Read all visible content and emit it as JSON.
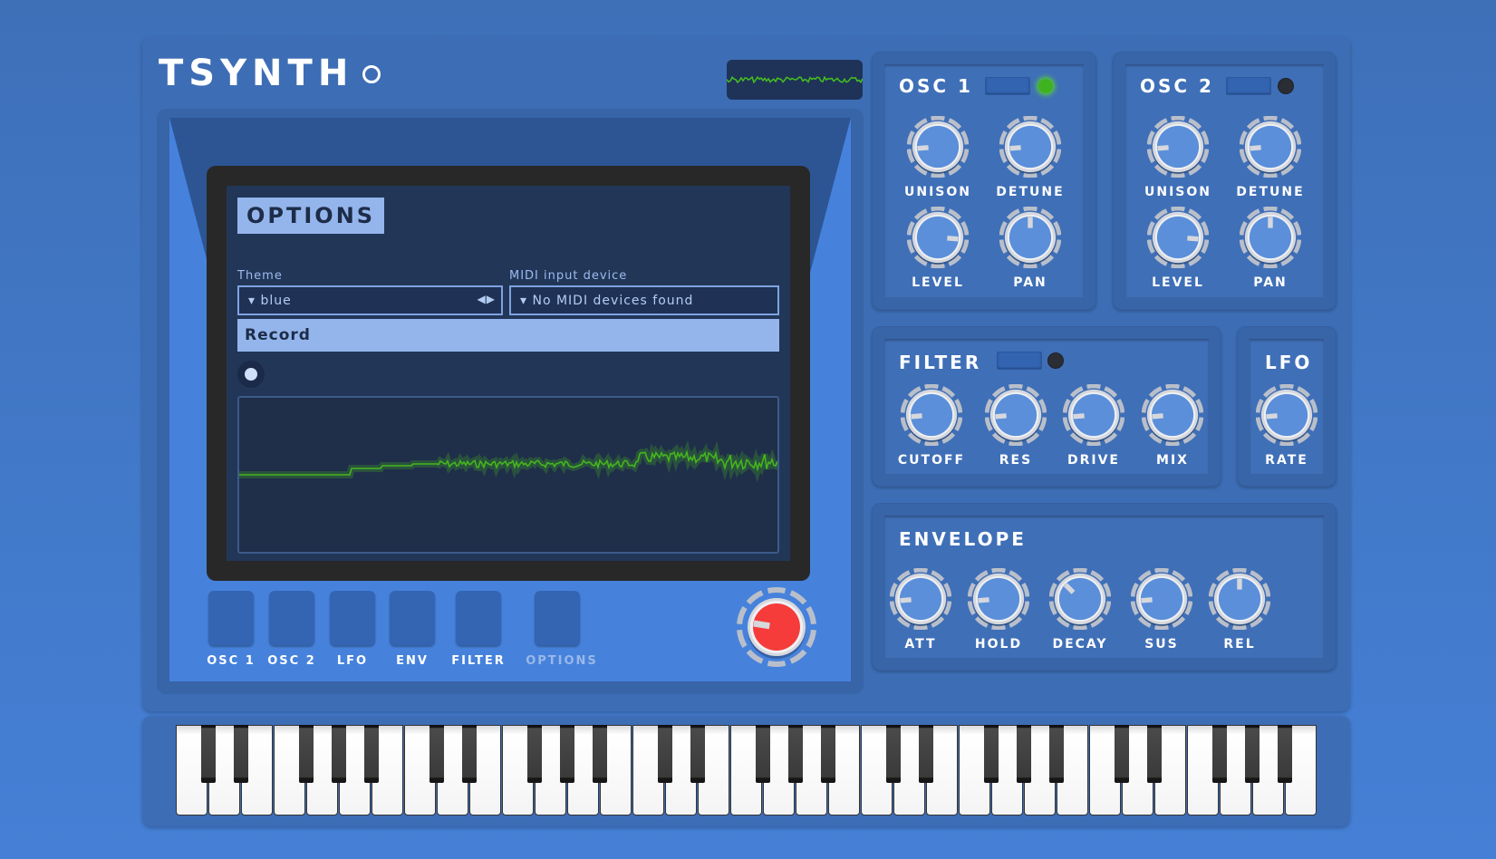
{
  "app": {
    "title": "TSYNTH",
    "github_icon": "github-icon"
  },
  "osc1": {
    "title": "OSC 1",
    "enabled": true,
    "knobs": [
      {
        "label": "UNISON",
        "value": 0.15
      },
      {
        "label": "DETUNE",
        "value": 0.15
      },
      {
        "label": "LEVEL",
        "value": 0.85
      },
      {
        "label": "PAN",
        "value": 0.5
      }
    ]
  },
  "osc2": {
    "title": "OSC 2",
    "enabled": false,
    "knobs": [
      {
        "label": "UNISON",
        "value": 0.15
      },
      {
        "label": "DETUNE",
        "value": 0.15
      },
      {
        "label": "LEVEL",
        "value": 0.85
      },
      {
        "label": "PAN",
        "value": 0.5
      }
    ]
  },
  "filter": {
    "title": "FILTER",
    "enabled": false,
    "knobs": [
      {
        "label": "CUTOFF",
        "value": 0.15
      },
      {
        "label": "RES",
        "value": 0.15
      },
      {
        "label": "DRIVE",
        "value": 0.15
      },
      {
        "label": "MIX",
        "value": 0.15
      }
    ]
  },
  "lfo": {
    "title": "LFO",
    "knobs": [
      {
        "label": "RATE",
        "value": 0.15
      }
    ]
  },
  "envelope": {
    "title": "ENVELOPE",
    "knobs": [
      {
        "label": "ATT",
        "value": 0.15
      },
      {
        "label": "HOLD",
        "value": 0.15
      },
      {
        "label": "DECAY",
        "value": 0.33
      },
      {
        "label": "SUS",
        "value": 0.15
      },
      {
        "label": "REL",
        "value": 0.5
      }
    ]
  },
  "screen": {
    "title": "OPTIONS",
    "theme_label": "Theme",
    "theme_value": "blue",
    "midi_label": "MIDI input device",
    "midi_value": "No MIDI devices found",
    "record_label": "Record"
  },
  "tabs": [
    {
      "label": "OSC 1",
      "active": false
    },
    {
      "label": "OSC 2",
      "active": false
    },
    {
      "label": "LFO",
      "active": false
    },
    {
      "label": "ENV",
      "active": false
    },
    {
      "label": "FILTER",
      "active": false
    },
    {
      "label": "OPTIONS",
      "active": true
    }
  ],
  "master_volume": {
    "value": 0.2
  },
  "colors": {
    "accent_green": "#3fb21f",
    "master_knob_red": "#f63b3b",
    "knob_face": "#5b8fda",
    "lcd_bg": "#223658",
    "lcd_highlight": "#94b5ec"
  },
  "keyboard": {
    "octaves": 5,
    "start_note": "C"
  }
}
